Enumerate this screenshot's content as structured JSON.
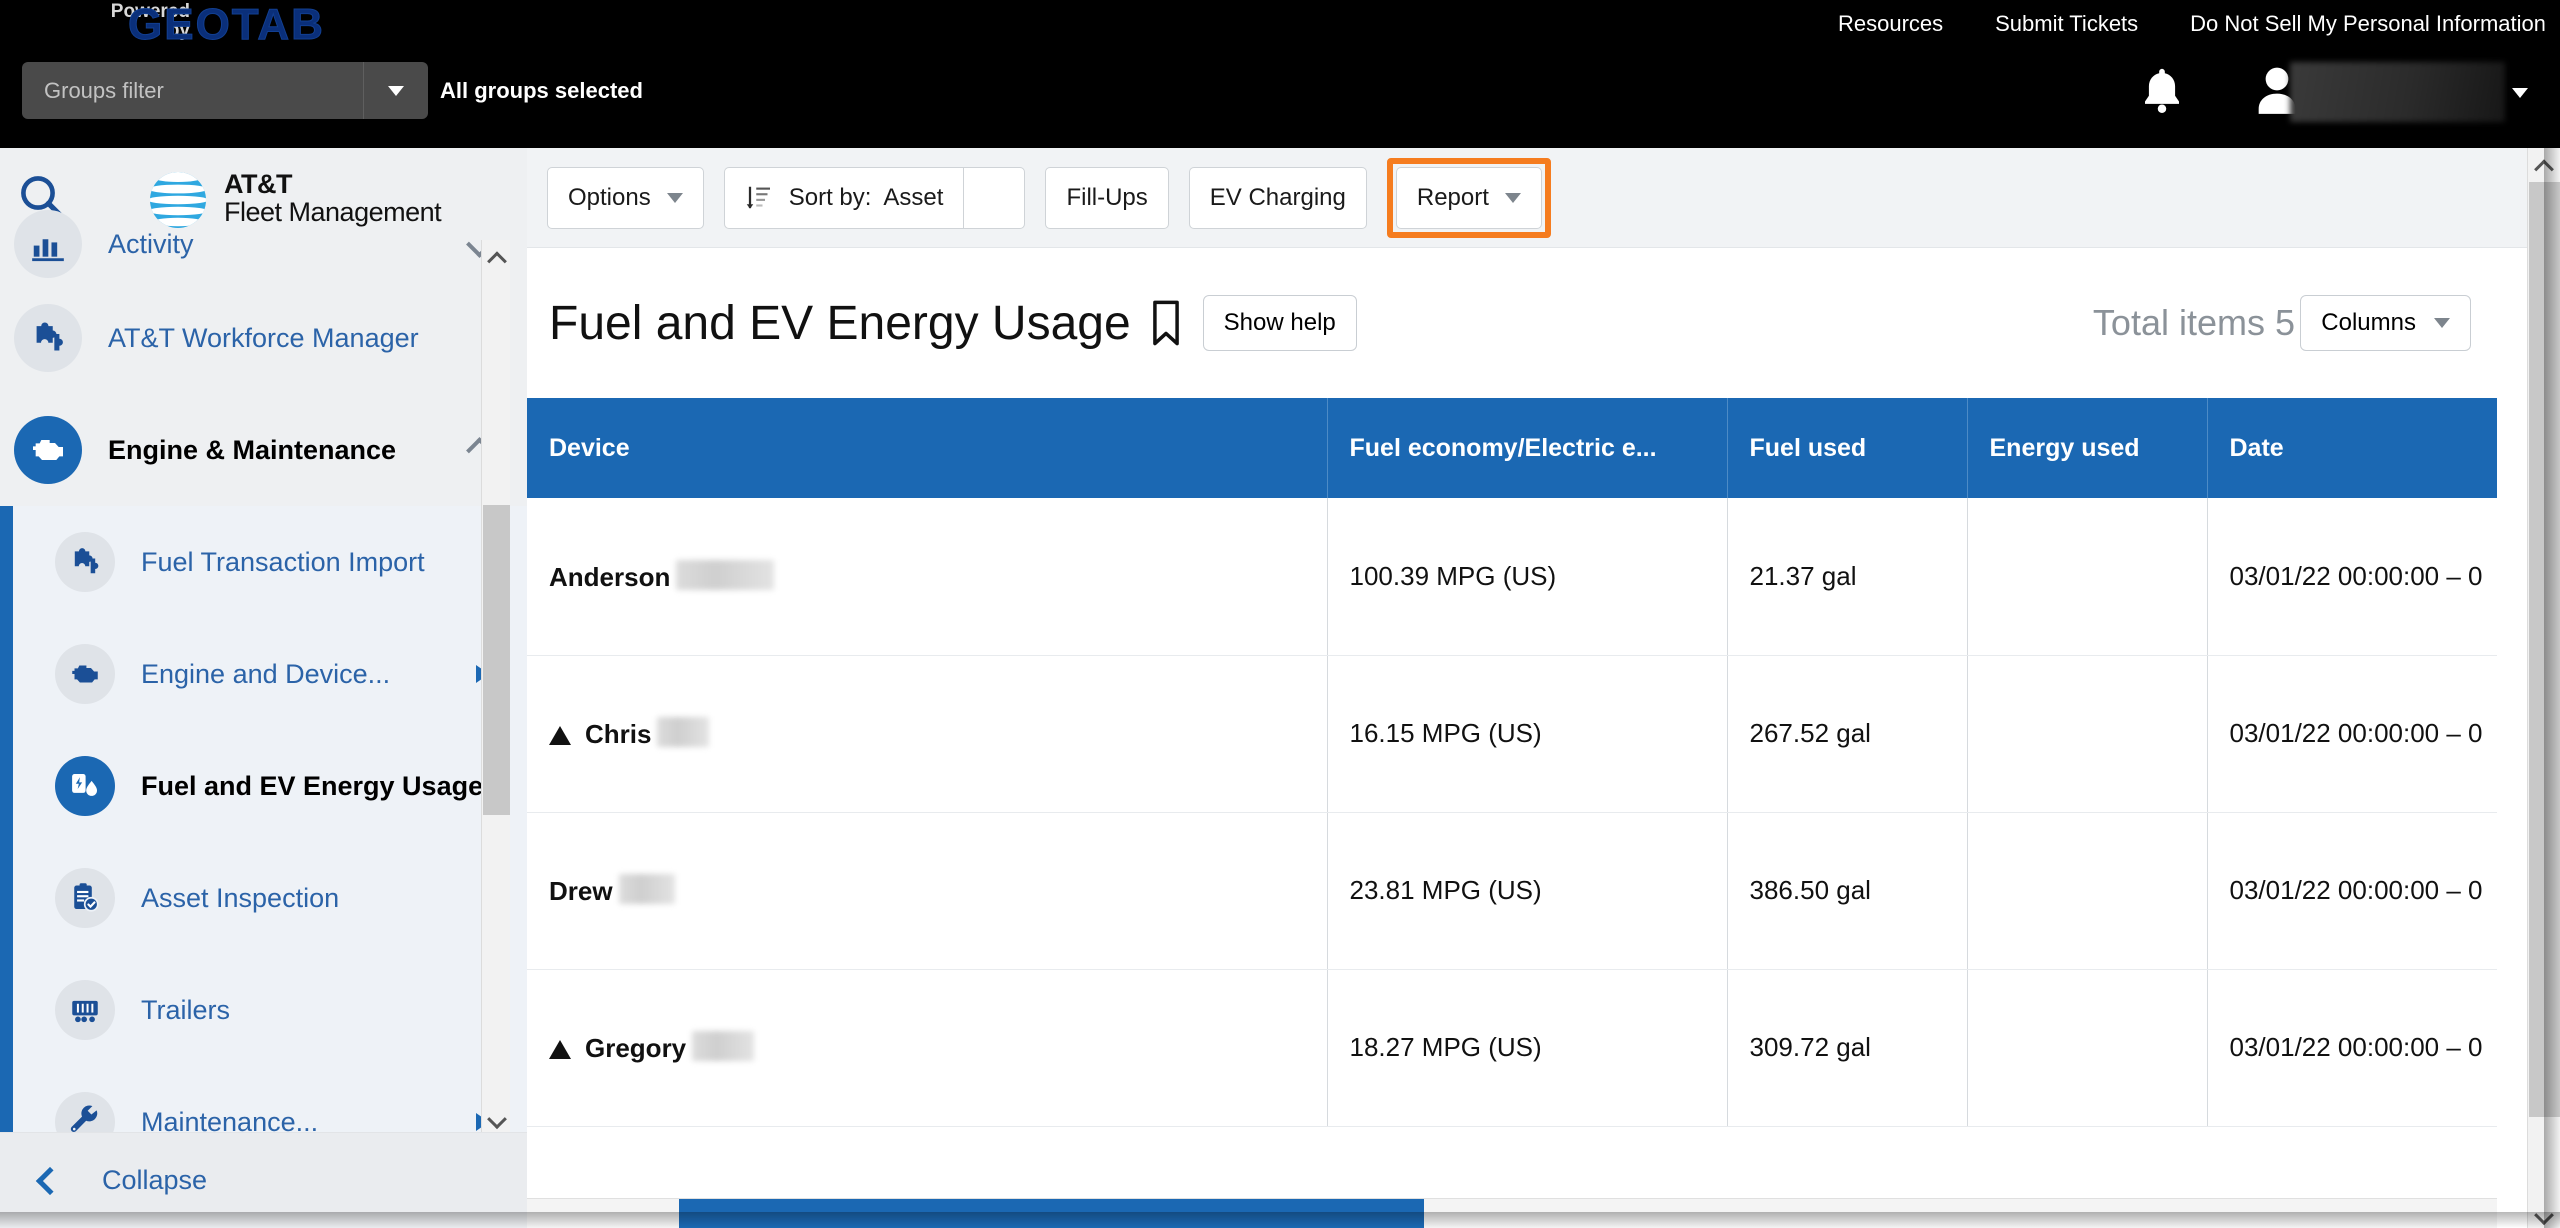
{
  "topbar": {
    "powered_line1": "Powered",
    "powered_line2": "by",
    "brand": "GEOTAB",
    "links": [
      {
        "label": "Resources"
      },
      {
        "label": "Submit Tickets"
      },
      {
        "label": "Do Not Sell My Personal Information"
      }
    ],
    "groups_filter_placeholder": "Groups filter",
    "all_groups_selected": "All groups selected",
    "notification_icon": "bell-icon",
    "user_icon": "user-avatar-icon",
    "user_name": ""
  },
  "sidebar": {
    "search_icon": "search-icon",
    "logo_line1": "AT&T",
    "logo_line2": "Fleet Management",
    "items": [
      {
        "label": "Activity",
        "icon": "bar-chart-icon",
        "state": "normal",
        "chevron": "down"
      },
      {
        "label": "AT&T Workforce Manager",
        "icon": "puzzle-icon",
        "state": "normal",
        "chevron": "none"
      },
      {
        "label": "Engine & Maintenance",
        "icon": "engine-icon",
        "state": "selected-parent",
        "chevron": "up"
      }
    ],
    "sub_items": [
      {
        "label": "Fuel Transaction Import",
        "icon": "puzzle-icon",
        "state": "normal",
        "arrow": "none"
      },
      {
        "label": "Engine and Device...",
        "icon": "engine-icon",
        "state": "normal",
        "arrow": "right"
      },
      {
        "label": "Fuel and EV Energy Usage",
        "icon": "fuel-ev-icon",
        "state": "active",
        "arrow": "none"
      },
      {
        "label": "Asset Inspection",
        "icon": "clipboard-check-icon",
        "state": "normal",
        "arrow": "none"
      },
      {
        "label": "Trailers",
        "icon": "trailer-icon",
        "state": "normal",
        "arrow": "none"
      },
      {
        "label": "Maintenance...",
        "icon": "wrench-icon",
        "state": "normal",
        "arrow": "right"
      }
    ],
    "collapse_label": "Collapse",
    "collapse_icon": "chevron-left-icon"
  },
  "toolbar": {
    "options_label": "Options",
    "sort_label": "Sort by:",
    "sort_value": "Asset",
    "sort_icon": "sort-ascending-icon",
    "fillups_label": "Fill-Ups",
    "ev_charging_label": "EV Charging",
    "report_label": "Report",
    "highlight_color": "#f57c1f"
  },
  "page": {
    "title": "Fuel and EV Energy Usage",
    "bookmark_icon": "bookmark-icon",
    "show_help_label": "Show help",
    "total_items_label": "Total items 5",
    "columns_label": "Columns"
  },
  "table": {
    "header_color": "#1b68b3",
    "columns": [
      "Device",
      "Fuel economy/Electric e...",
      "Fuel used",
      "Energy used",
      "Date"
    ],
    "rows": [
      {
        "warning": false,
        "device": "Anderson",
        "redact_width": 98,
        "fuel_economy": "100.39 MPG (US)",
        "fuel_used": "21.37 gal",
        "energy_used": "",
        "date": "03/01/22 00:00:00 – 0"
      },
      {
        "warning": true,
        "device": "Chris",
        "redact_width": 52,
        "fuel_economy": "16.15 MPG (US)",
        "fuel_used": "267.52 gal",
        "energy_used": "",
        "date": "03/01/22 00:00:00 – 0"
      },
      {
        "warning": false,
        "device": "Drew",
        "redact_width": 56,
        "fuel_economy": "23.81 MPG (US)",
        "fuel_used": "386.50 gal",
        "energy_used": "",
        "date": "03/01/22 00:00:00 – 0"
      },
      {
        "warning": true,
        "device": "Gregory",
        "redact_width": 62,
        "fuel_economy": "18.27 MPG (US)",
        "fuel_used": "309.72 gal",
        "energy_used": "",
        "date": "03/01/22 00:00:00 – 0"
      }
    ]
  }
}
